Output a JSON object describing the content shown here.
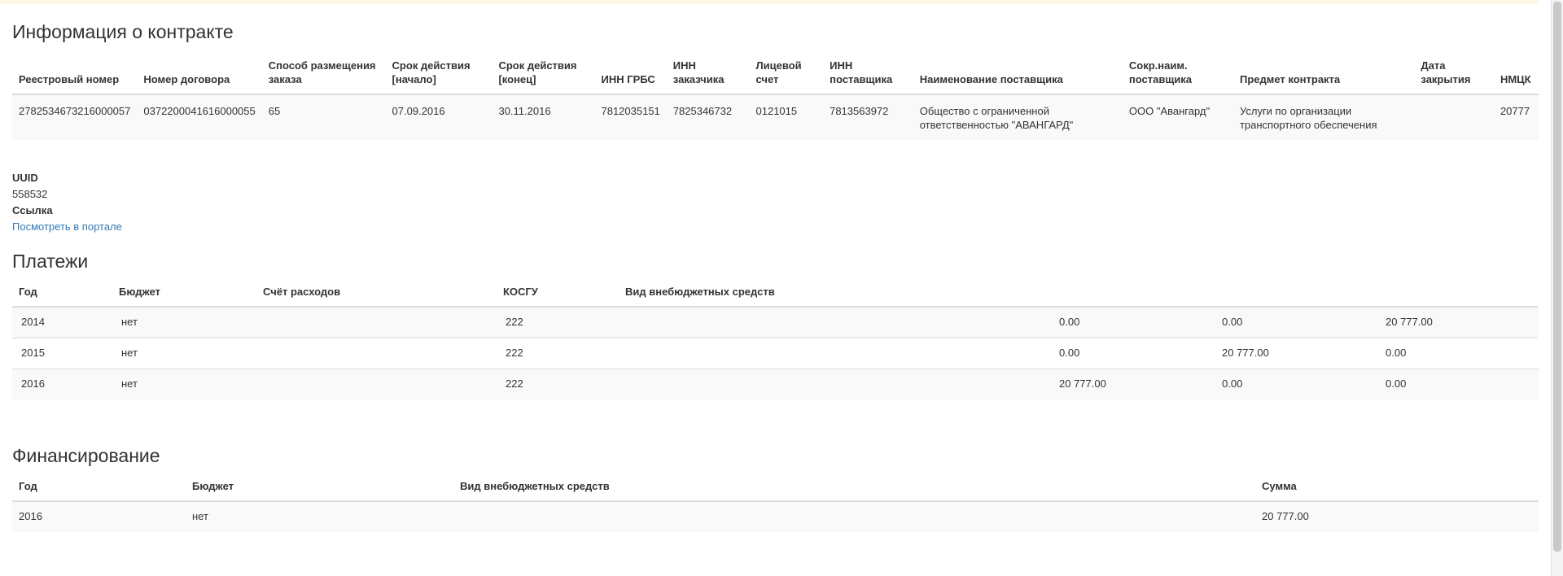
{
  "contract": {
    "title": "Информация о контракте",
    "headers": [
      "Реестровый номер",
      "Номер договора",
      "Способ размещения заказа",
      "Срок действия [начало]",
      "Срок действия [конец]",
      "ИНН ГРБС",
      "ИНН заказчика",
      "Лицевой счет",
      "ИНН поставщика",
      "Наименование поставщика",
      "Сокр.наим. поставщика",
      "Предмет контракта",
      "Дата закрытия",
      "НМЦК"
    ],
    "row": [
      "2782534673216000057",
      "0372200041616000055",
      "65",
      "07.09.2016",
      "30.11.2016",
      "7812035151",
      "7825346732",
      "0121015",
      "7813563972",
      "Общество с ограниченной ответственностью \"АВАНГАРД\"",
      "ООО \"Авангард\"",
      "Услуги по организации транспортного обеспечения",
      "",
      "20777"
    ]
  },
  "meta": {
    "uuid_label": "UUID",
    "uuid_value": "558532",
    "link_label": "Ссылка",
    "link_text": "Посмотреть в портале"
  },
  "payments": {
    "title": "Платежи",
    "headers": [
      "Год",
      "Бюджет",
      "Счёт расходов",
      "КОСГУ",
      "Вид внебюджетных средств",
      "",
      "",
      ""
    ],
    "rows": [
      [
        "2014",
        "нет",
        "",
        "222",
        "",
        "0.00",
        "0.00",
        "20 777.00"
      ],
      [
        "2015",
        "нет",
        "",
        "222",
        "",
        "0.00",
        "20 777.00",
        "0.00"
      ],
      [
        "2016",
        "нет",
        "",
        "222",
        "",
        "20 777.00",
        "0.00",
        "0.00"
      ]
    ]
  },
  "financing": {
    "title": "Финансирование",
    "headers": [
      "Год",
      "Бюджет",
      "Вид внебюджетных средств",
      "Сумма"
    ],
    "rows": [
      [
        "2016",
        "нет",
        "",
        "20 777.00"
      ]
    ]
  }
}
